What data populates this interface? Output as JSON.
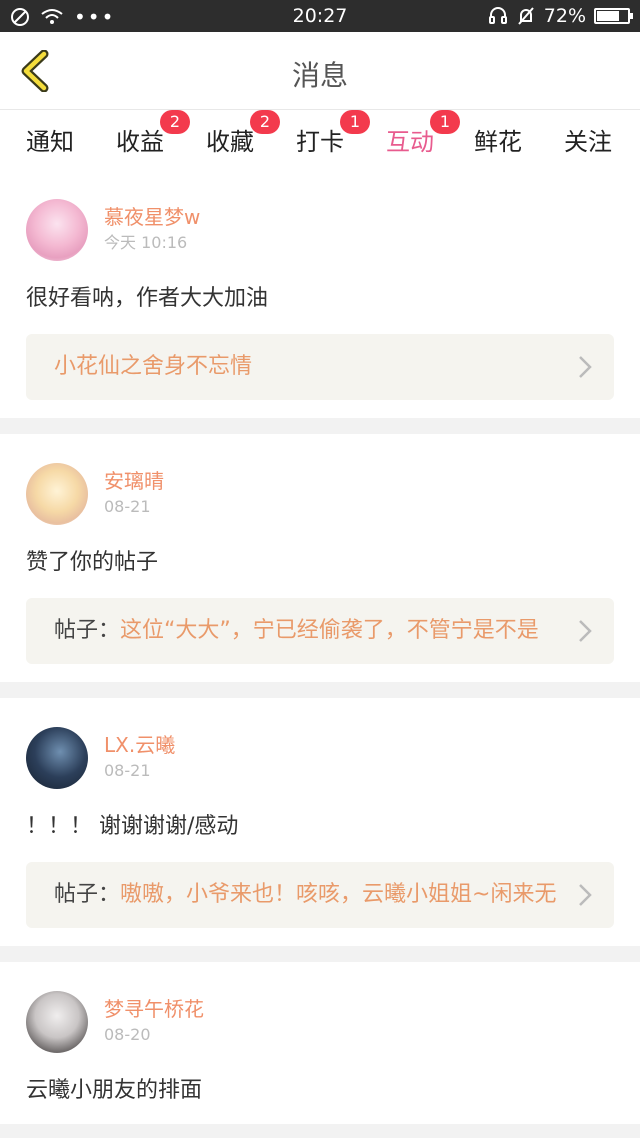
{
  "status": {
    "time": "20:27",
    "battery": "72%",
    "battery_level": 0.72
  },
  "header": {
    "title": "消息",
    "back_icon": "chevron-left-icon"
  },
  "tabs": [
    {
      "label": "通知",
      "badge": ""
    },
    {
      "label": "收益",
      "badge": "2"
    },
    {
      "label": "收藏",
      "badge": "2"
    },
    {
      "label": "打卡",
      "badge": "1"
    },
    {
      "label": "互动",
      "badge": "1",
      "active": true
    },
    {
      "label": "鲜花",
      "badge": ""
    },
    {
      "label": "关注",
      "badge": ""
    }
  ],
  "colors": {
    "accent": "#e85b8e",
    "username": "#f0906a",
    "badge": "#f33a4d",
    "refText": "#e99a6a"
  },
  "messages": [
    {
      "user": "慕夜星梦w",
      "time": "今天 10:16",
      "text": "很好看呐，作者大大加油",
      "ref_label": "",
      "ref_text": "小花仙之舍身不忘情"
    },
    {
      "user": "安璃晴",
      "time": "08-21",
      "text": "赞了你的帖子",
      "ref_label": "帖子：",
      "ref_text": "这位“大大”，宁已经偷袭了，不管宁是不是"
    },
    {
      "user": "LX.云曦",
      "time": "08-21",
      "text": "！！！ 谢谢谢谢/感动",
      "ref_label": "帖子：",
      "ref_text": "嗷嗷，小爷来也！咳咳，云曦小姐姐~闲来无"
    },
    {
      "user": "梦寻午桥花",
      "time": "08-20",
      "text": "云曦小朋友的排面",
      "ref_label": "",
      "ref_text": ""
    }
  ]
}
